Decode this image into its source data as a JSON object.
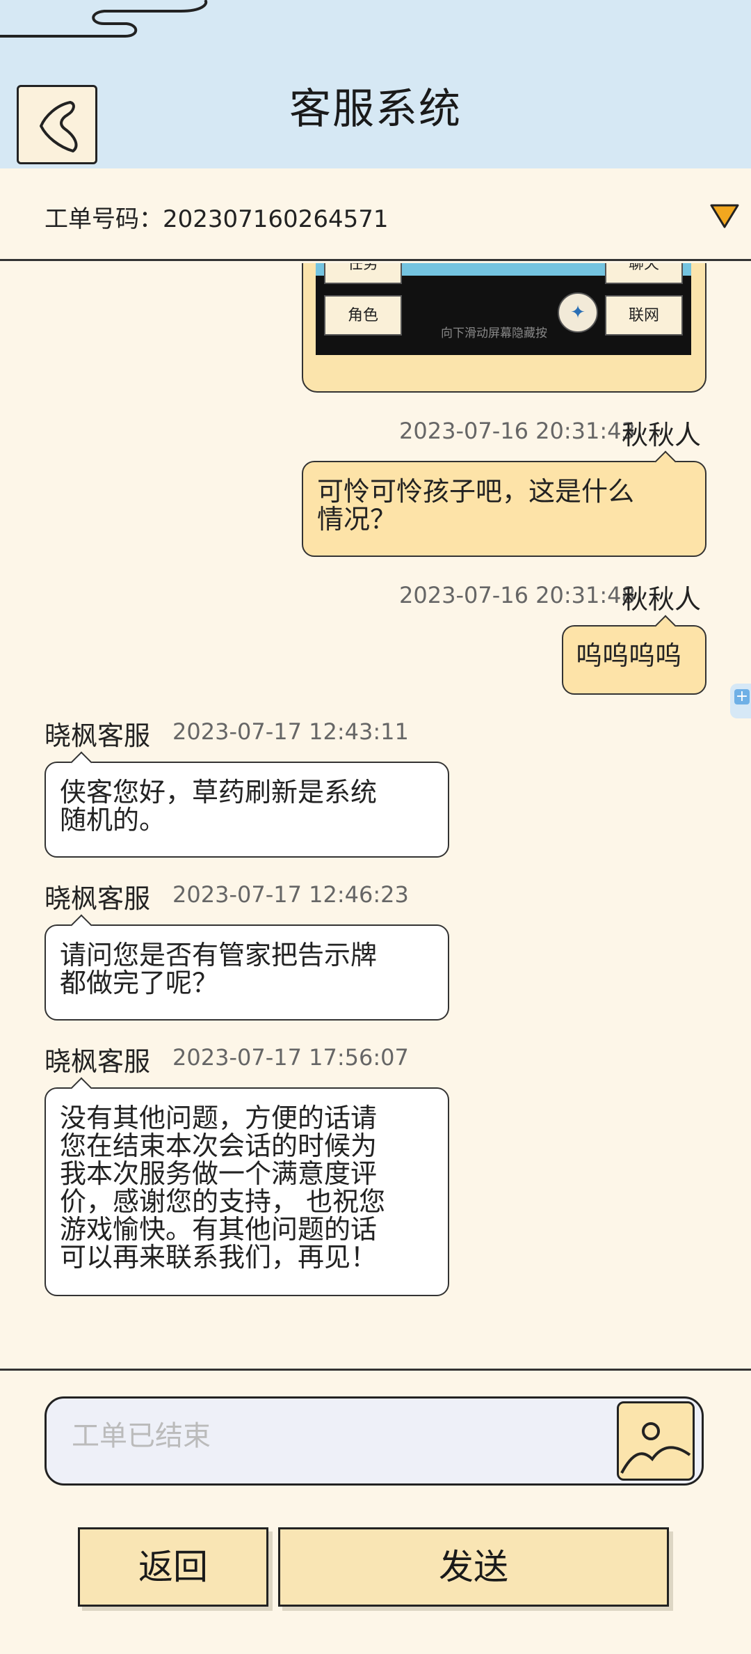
{
  "header": {
    "title": "客服系统"
  },
  "ticket": {
    "text": "工单号码：202307160264571"
  },
  "screenshot_preview": {
    "buttons": [
      "任务",
      "聊天",
      "角色",
      "联网"
    ],
    "hint": "向下滑动屏幕隐藏按"
  },
  "messages": [
    {
      "sender": "秋秋人",
      "time": "2023-07-16 20:31:43",
      "lines": [
        "可怜可怜孩子吧，这是什么",
        "情况？"
      ]
    },
    {
      "sender": "秋秋人",
      "time": "2023-07-16 20:31:48",
      "lines": [
        "呜呜呜呜"
      ]
    },
    {
      "sender": "晓枫客服",
      "time": "2023-07-17 12:43:11",
      "lines": [
        "侠客您好，草药刷新是系统",
        "随机的。"
      ]
    },
    {
      "sender": "晓枫客服",
      "time": "2023-07-17 12:46:23",
      "lines": [
        "请问您是否有管家把告示牌",
        "都做完了呢？"
      ]
    },
    {
      "sender": "晓枫客服",
      "time": "2023-07-17 17:56:07",
      "lines": [
        "没有其他问题，方便的话请",
        "您在结束本次会话的时候为",
        "我本次服务做一个满意度评",
        "价，感谢您的支持， 也祝您",
        "游戏愉快。有其他问题的话",
        "可以再来联系我们，再见！"
      ]
    }
  ],
  "input": {
    "placeholder": "工单已结束",
    "value": ""
  },
  "footer": {
    "back_label": "返回",
    "send_label": "发送"
  },
  "colors": {
    "header_bg": "#d6e8f4",
    "page_bg": "#fdf6e8",
    "user_bubble": "#fde3a8",
    "cs_bubble": "#ffffff",
    "dropdown": "#f2a71f"
  }
}
